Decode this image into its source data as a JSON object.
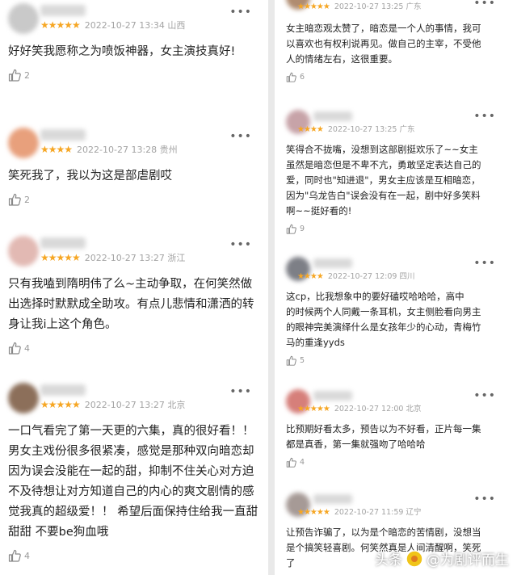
{
  "left": [
    {
      "meta": "2022-10-27 13:34 山西",
      "text": "好好笑我愿称之为喷饭神器，女主演技真好!",
      "likes": "2",
      "avatar": "#c9c9c9"
    },
    {
      "meta": "2022-10-27 13:28 贵州",
      "text": "笑死我了，我以为这是部虐剧哎",
      "likes": "2",
      "avatar": "#e8a07c"
    },
    {
      "meta": "2022-10-27 13:27 浙江",
      "text": "只有我嗑到隋明伟了么~主动争取，在何笑然做\n出选择时默默成全助攻。有点儿悲情和潇洒的转\n身让我i上这个角色。",
      "likes": "4",
      "avatar": "#e2b9b3"
    },
    {
      "meta": "2022-10-27 13:27 北京",
      "text": "一口气看完了第一天更的六集，真的很好看！！\n男女主戏份很多很紧凑，感觉是那种双向暗恋却\n因为误会没能在一起的甜，抑制不住关心对方迫\n不及待想让对方知道自己的内心的爽文剧情的感\n觉我真的超级爱！！ 希望后面保持住给我一直甜\n甜甜 不要be狗血哦",
      "likes": "4",
      "avatar": "#8c6f5a"
    }
  ],
  "right": [
    {
      "meta": "2022-10-27 13:25 广东",
      "text": "女主暗恋观太赞了，暗恋是一个人的事情，我可\n以喜欢也有权利说再见。做自己的主宰，不受他\n人的情绪左右，这很重要。",
      "likes": "6",
      "avatar": "#b08c70"
    },
    {
      "meta": "2022-10-27 13:25 广东",
      "text": "笑得合不拢嘴，没想到这部剧挺欢乐了~~女主\n虽然是暗恋但是不卑不亢，勇敢坚定表达自己的\n爱，同时也\"知进退\"，男女主应该是互相暗恋，\n因为\"乌龙告白\"误会没有在一起，剧中好多笑料\n啊~~挺好看的!",
      "likes": "9",
      "avatar": "#c7a3a8"
    },
    {
      "meta": "2022-10-27 12:09 四川",
      "text": "这cp，比我想象中的要好磕哎哈哈哈，高中\n的时候两个人同戴一条耳机，女主侧脸看向男主\n的眼神完美演绎什么是女孩年少的心动，青梅竹\n马的重逢yyds",
      "likes": "5",
      "avatar": "#7d7f86"
    },
    {
      "meta": "2022-10-27 12:00 北京",
      "text": "比预期好看太多，预告以为不好看，正片每一集\n都是真香，第一集就强吻了哈哈哈",
      "likes": "4",
      "avatar": "#d67f7a"
    },
    {
      "meta": "2022-10-27 11:59 辽宁",
      "text": "让预告诈骗了，以为是个暗恋的苦情剧，没想当\n是个搞笑轻喜剧。何笑然真是人间清醒啊，笑死\n了",
      "likes": "",
      "avatar": "#a69a96"
    }
  ],
  "stars": "★★★★★",
  "stars4": "★★★★",
  "more_icon": "•••",
  "watermark": {
    "prefix": "头条",
    "text": "@为剧评而生"
  },
  "colors": {
    "star": "#f6a623",
    "meta": "#a3a3a3",
    "text": "#222222"
  }
}
